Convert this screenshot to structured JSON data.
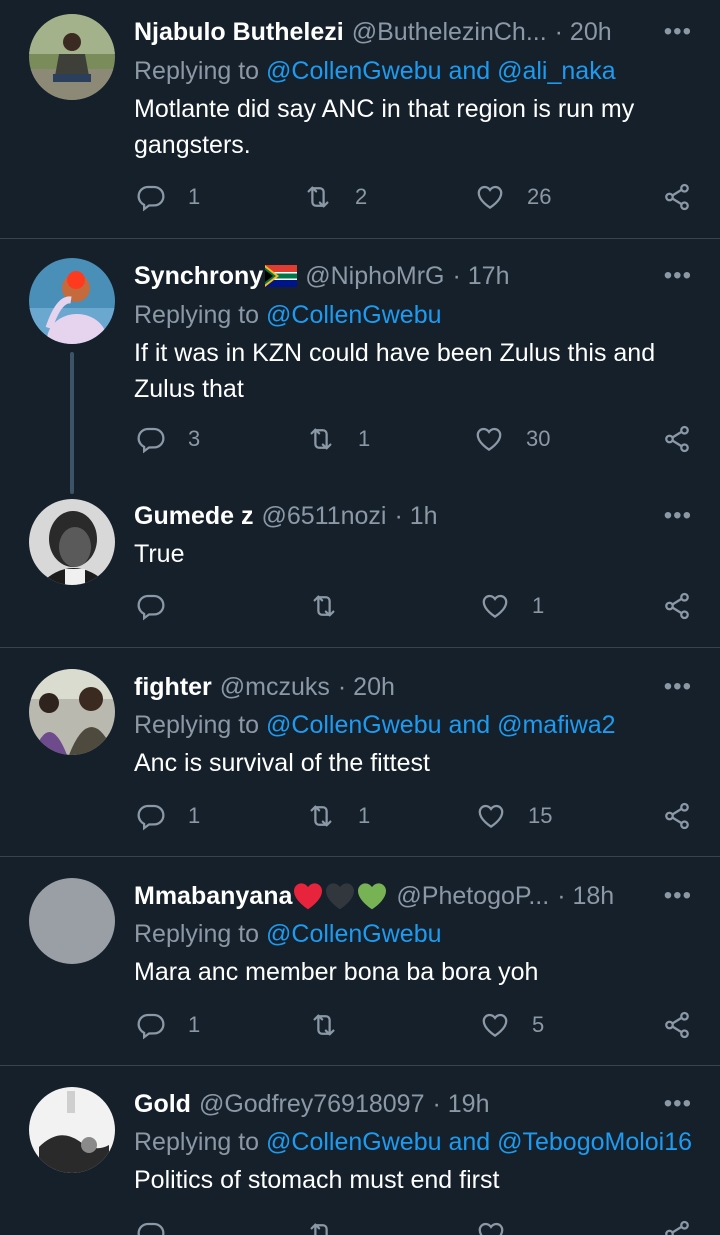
{
  "tweets": [
    {
      "name": "Njabulo Buthelezi",
      "handle": "@ButhelezinCh...",
      "time": "· 20h",
      "replying_prefix": "Replying to ",
      "mentions": "@CollenGwebu and @ali_naka",
      "text": "Motlante did say ANC in that region is run my gangsters.",
      "replies": "1",
      "retweets": "2",
      "likes": "26"
    },
    {
      "name": "Synchrony",
      "handle": "@NiphoMrG",
      "time": "· 17h",
      "replying_prefix": "Replying to ",
      "mentions": "@CollenGwebu",
      "text": "If it was in KZN could have been Zulus this and Zulus that",
      "replies": "3",
      "retweets": "1",
      "likes": "30"
    },
    {
      "name": "Gumede z",
      "handle": "@6511nozi",
      "time": "· 1h",
      "text": "True",
      "replies": "",
      "retweets": "",
      "likes": "1"
    },
    {
      "name": "fighter",
      "handle": "@mczuks",
      "time": "· 20h",
      "replying_prefix": "Replying to ",
      "mentions": "@CollenGwebu and @mafiwa2",
      "text": "Anc is survival of the fittest",
      "replies": "1",
      "retweets": "1",
      "likes": "15"
    },
    {
      "name": "Mmabanyana",
      "handle": "@PhetogoP...",
      "time": "· 18h",
      "replying_prefix": "Replying to ",
      "mentions": "@CollenGwebu",
      "text": "Mara anc member bona ba bora yoh",
      "replies": "1",
      "retweets": "",
      "likes": "5"
    },
    {
      "name": "Gold",
      "handle": "@Godfrey76918097",
      "time": "· 19h",
      "replying_prefix": "Replying to ",
      "mentions": "@CollenGwebu and @TebogoMoloi16",
      "text": "Politics of stomach must end first",
      "replies": "",
      "retweets": "",
      "likes": ""
    }
  ],
  "more_glyph": "•••",
  "colors": {
    "background": "#15202b",
    "accent": "#1d9bf0",
    "secondary_text": "#8b98a5",
    "divider": "#38444d"
  }
}
